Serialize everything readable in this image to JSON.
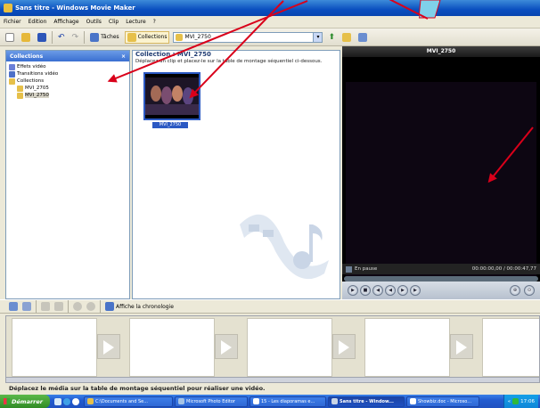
{
  "window": {
    "title": "Sans titre - Windows Movie Maker"
  },
  "menu": [
    "Fichier",
    "Edition",
    "Affichage",
    "Outils",
    "Clip",
    "Lecture",
    "?"
  ],
  "toolbar": {
    "tasks_label": "Tâches",
    "collections_label": "Collections",
    "collection_select": "MVI_2750"
  },
  "left_panel": {
    "header": "Collections",
    "close": "×",
    "items": [
      "Effets vidéo",
      "Transitions vidéo",
      "Collections",
      "MVI_2705",
      "MVI_2750"
    ]
  },
  "collection": {
    "title": "Collection : MVI_2750",
    "hint": "Déplacez un clip et placez-le sur la table de montage séquentiel ci-dessous.",
    "clip_name": "MVI_2750"
  },
  "preview": {
    "title": "MVI_2750",
    "status": "En pause",
    "time": "00:00:00,00 / 00:00:47,77"
  },
  "storyboard": {
    "timeline_label": "Affiche la chronologie",
    "drop_hint": "Déplacez le média sur la table de montage séquentiel pour réaliser une vidéo."
  },
  "taskbar": {
    "start": "Démarrer",
    "tasks": [
      "C:\\Documents and Se...",
      "Microsoft Photo Editor",
      "15 - Les diaporamas e...",
      "Sans titre - Window...",
      "Showbiz.doc - Microso..."
    ],
    "clock": "17:06"
  }
}
